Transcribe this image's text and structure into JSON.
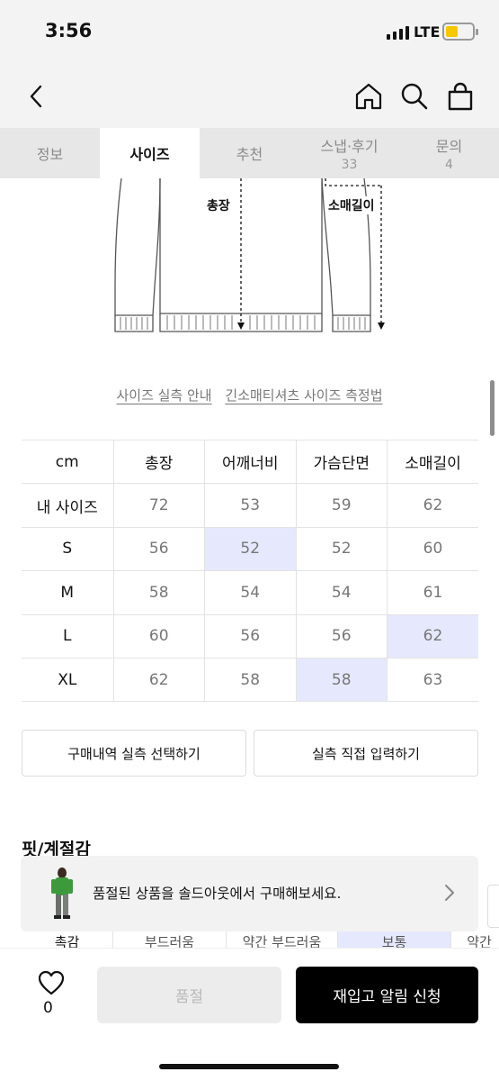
{
  "status_bar": {
    "time": "3:56",
    "network": "LTE"
  },
  "header": {
    "back_icon": "chevron-left-icon",
    "home_icon": "home-icon",
    "search_icon": "search-icon",
    "cart_icon": "shopping-bag-icon"
  },
  "tabs": [
    {
      "label": "정보",
      "count": ""
    },
    {
      "label": "사이즈",
      "count": ""
    },
    {
      "label": "추천",
      "count": ""
    },
    {
      "label": "스냅·후기",
      "count": "33"
    },
    {
      "label": "문의",
      "count": "4"
    }
  ],
  "active_tab": "사이즈",
  "diagram": {
    "length_label": "총장",
    "sleeve_label": "소매길이"
  },
  "links": {
    "guide": "사이즈 실측 안내",
    "method": "긴소매티셔츠 사이즈 측정법"
  },
  "size_table": {
    "headers": [
      "cm",
      "총장",
      "어깨너비",
      "가슴단면",
      "소매길이"
    ],
    "rows": [
      {
        "label": "내 사이즈",
        "values": [
          "72",
          "53",
          "59",
          "62"
        ]
      },
      {
        "label": "S",
        "values": [
          "56",
          "52",
          "52",
          "60"
        ]
      },
      {
        "label": "M",
        "values": [
          "58",
          "54",
          "54",
          "61"
        ]
      },
      {
        "label": "L",
        "values": [
          "60",
          "56",
          "56",
          "62"
        ]
      },
      {
        "label": "XL",
        "values": [
          "62",
          "58",
          "58",
          "63"
        ]
      }
    ],
    "highlight_color": "#e6e9fd"
  },
  "buttons": {
    "select_purchase": "구매내역 실측 선택하기",
    "direct_input": "실측 직접 입력하기"
  },
  "fit": {
    "title": "핏/계절감",
    "row_label": "촉감",
    "options": [
      "부드러움",
      "약간 부드러움",
      "보통",
      "약간"
    ]
  },
  "banner": {
    "text": "품절된 상품을 솔드아웃에서 구매해보세요."
  },
  "bottom_bar": {
    "like_count": "0",
    "soldout_label": "품절",
    "restock_label": "재입고 알림 신청",
    "accent": "#000000"
  }
}
